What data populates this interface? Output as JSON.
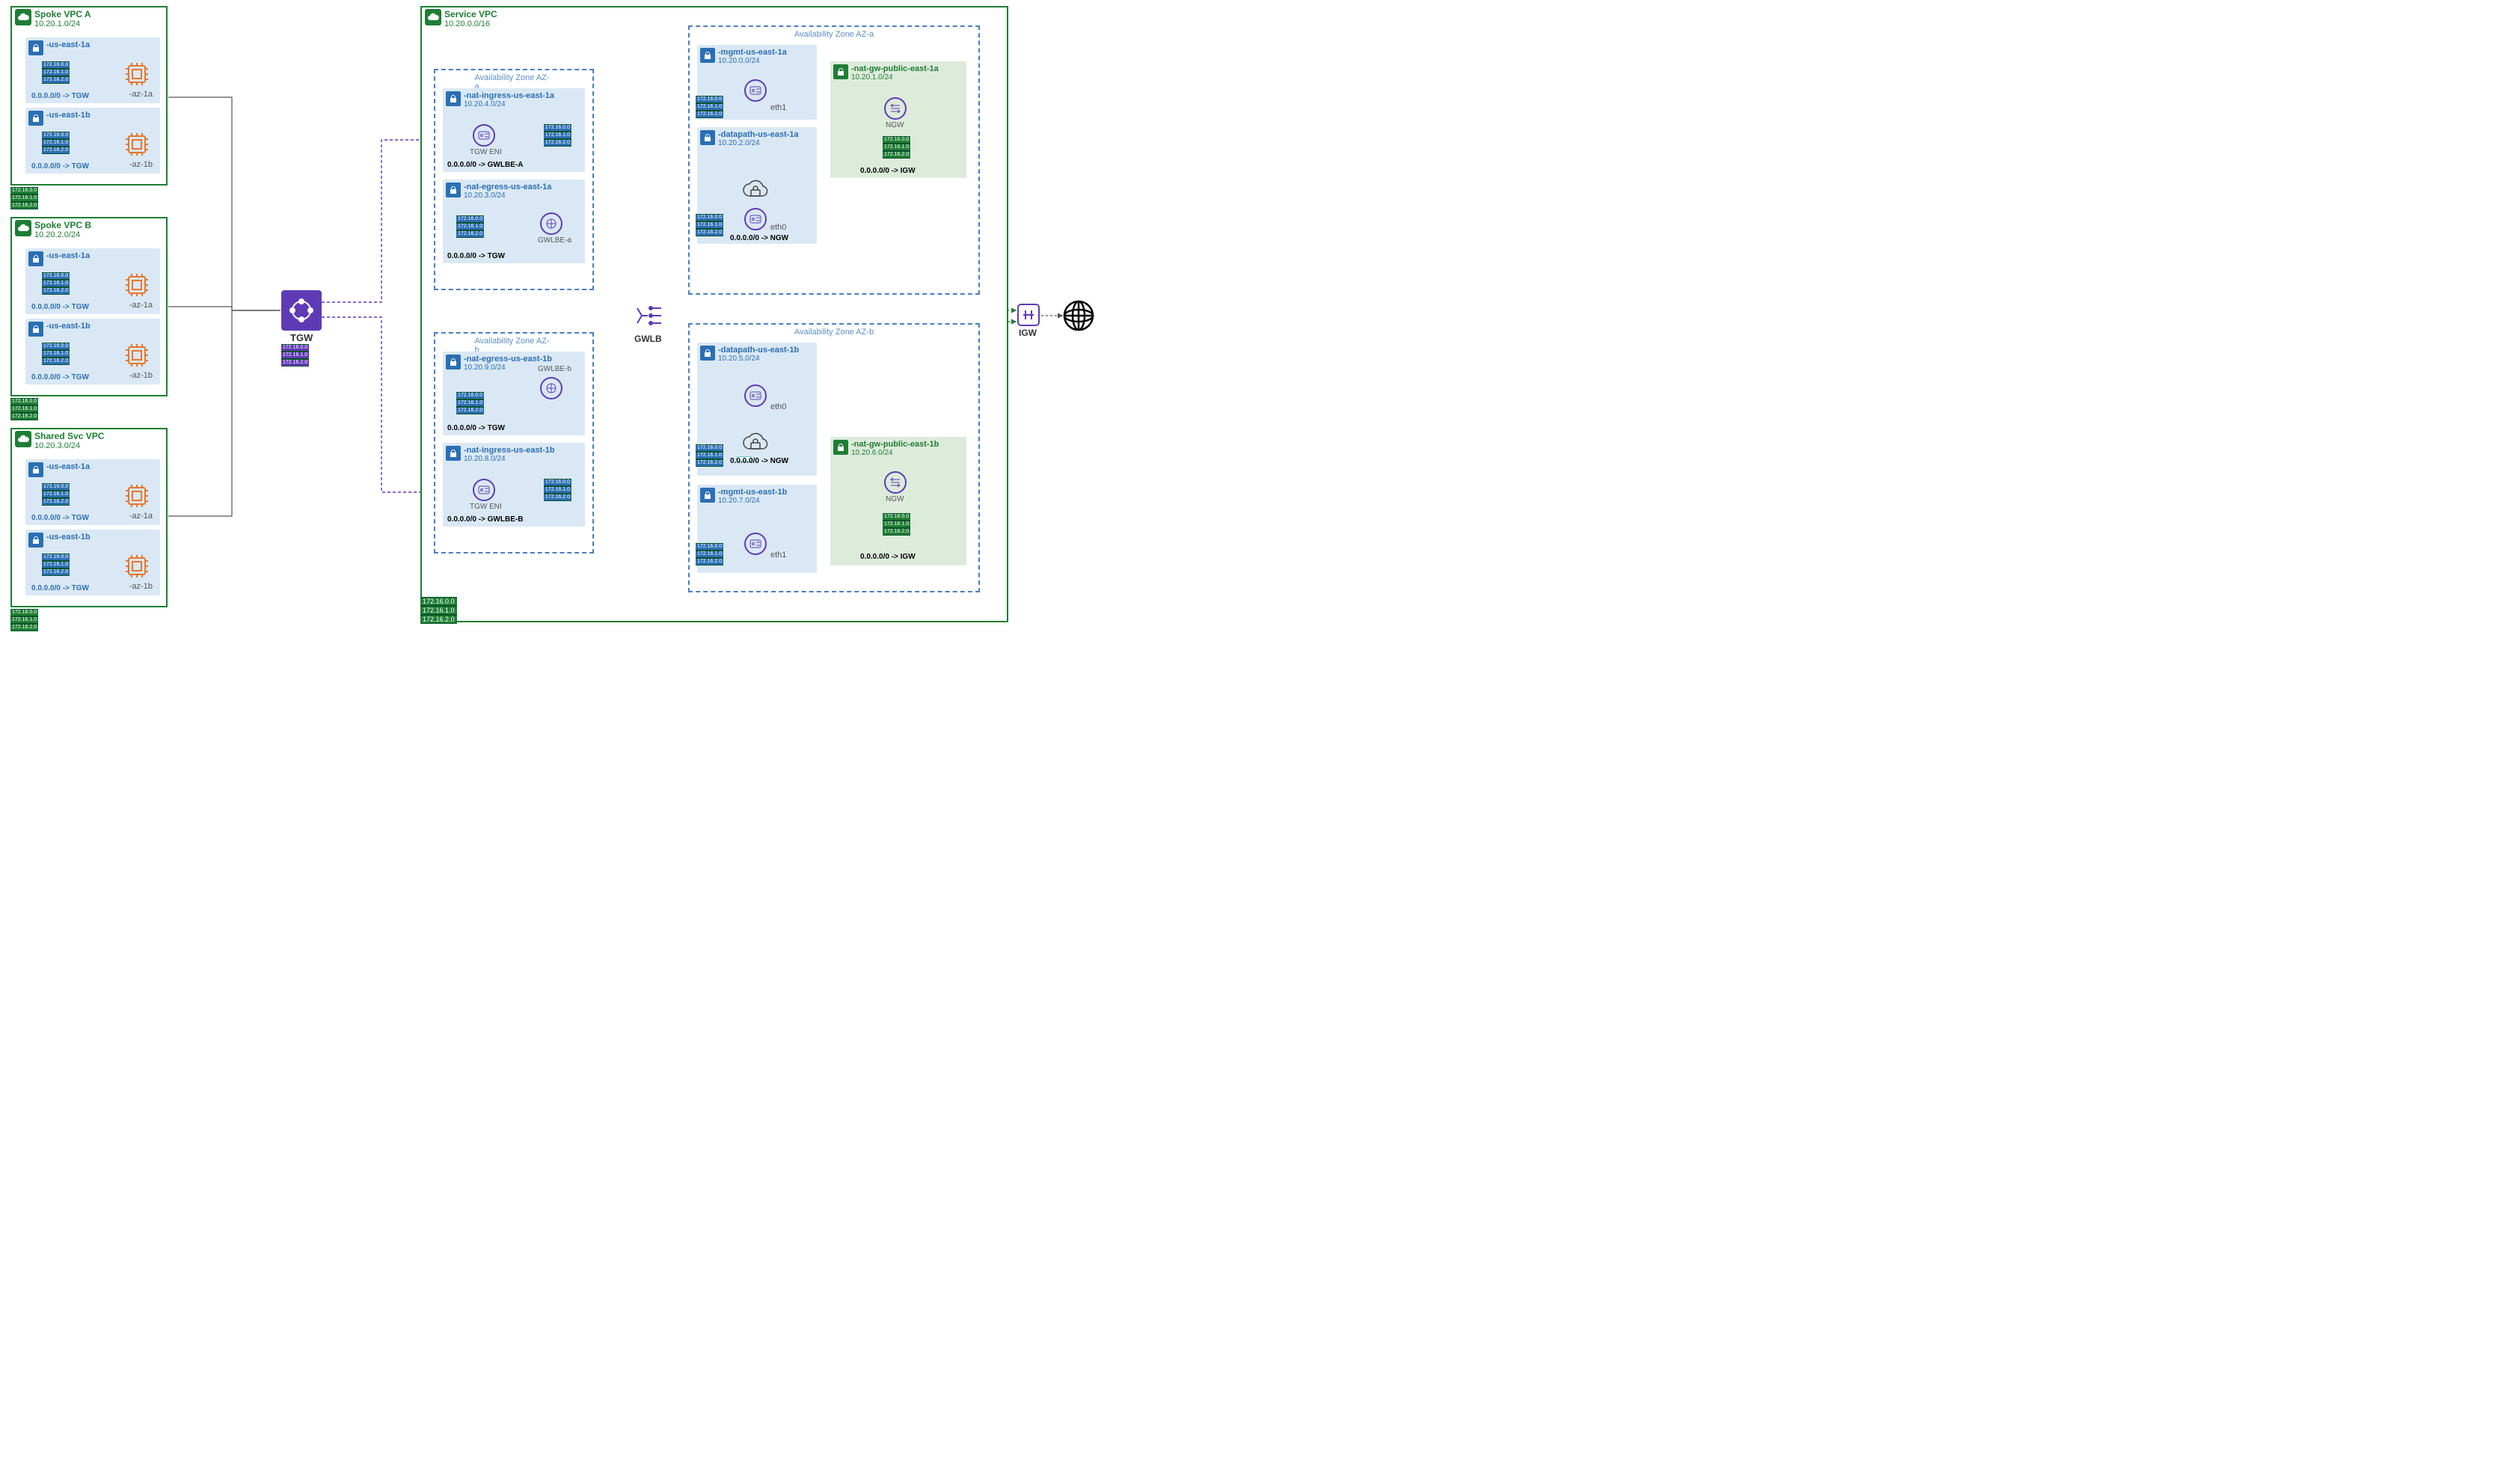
{
  "colors": {
    "green": "#1e7e34",
    "blue": "#2b6fb3",
    "orange": "#e8762d",
    "purple": "#5e3bb5",
    "teal": "#1fb6c1"
  },
  "rt": {
    "r1": "172.16.0.0",
    "r2": "172.16.1.0",
    "r3": "172.16.2.0"
  },
  "rt_svc": {
    "r1": "172.16.0.0",
    "r2": "172.16.1.0",
    "r3": "172.16.2.0"
  },
  "spokeA": {
    "title": "Spoke VPC A",
    "cidr": "10.20.1.0/24",
    "s1": {
      "name": "-us-east-1a",
      "route": "0.0.0.0/0 -> TGW",
      "chip": "-az-1a"
    },
    "s2": {
      "name": "-us-east-1b",
      "route": "0.0.0.0/0 -> TGW",
      "chip": "-az-1b"
    }
  },
  "spokeB": {
    "title": "Spoke VPC B",
    "cidr": "10.20.2.0/24",
    "s1": {
      "name": "-us-east-1a",
      "route": "0.0.0.0/0 -> TGW",
      "chip": "-az-1a"
    },
    "s2": {
      "name": "-us-east-1b",
      "route": "0.0.0.0/0 -> TGW",
      "chip": "-az-1b"
    }
  },
  "shared": {
    "title": "Shared Svc VPC",
    "cidr": "10.20.3.0/24",
    "s1": {
      "name": "-us-east-1a",
      "route": "0.0.0.0/0 -> TGW",
      "chip": "-az-1a"
    },
    "s2": {
      "name": "-us-east-1b",
      "route": "0.0.0.0/0 -> TGW",
      "chip": "-az-1b"
    }
  },
  "tgw": {
    "label": "TGW"
  },
  "service": {
    "title": "Service VPC",
    "cidr": "10.20.0.0/16"
  },
  "azA": {
    "label": "Availability Zone AZ-a",
    "natIngress": {
      "name": "-nat-ingress-us-east-1a",
      "cidr": "10.20.4.0/24",
      "route": "0.0.0.0/0 -> GWLBE-A",
      "eni": "TGW ENI"
    },
    "natEgress": {
      "name": "-nat-egress-us-east-1a",
      "cidr": "10.20.3.0/24",
      "route": "0.0.0.0/0 -> TGW",
      "ep": "GWLBE-a"
    }
  },
  "azB": {
    "label": "Availability Zone AZ-b",
    "natEgress": {
      "name": "-nat-egress-us-east-1b",
      "cidr": "10.20.9.0/24",
      "route": "0.0.0.0/0 -> TGW",
      "ep": "GWLBE-b"
    },
    "natIngress": {
      "name": "-nat-ingress-us-east-1b",
      "cidr": "10.20.8.0/24",
      "route": "0.0.0.0/0 -> GWLBE-B",
      "eni": "TGW ENI"
    }
  },
  "gwlb": {
    "label": "GWLB"
  },
  "azAr": {
    "label": "Availability Zone AZ-a",
    "mgmt": {
      "name": "-mgmt-us-east-1a",
      "cidr": "10.20.0.0/24",
      "eth": "eth1"
    },
    "data": {
      "name": "-datapath-us-east-1a",
      "cidr": "10.20.2.0/24",
      "eth": "eth0",
      "route": "0.0.0.0/0 -> NGW"
    },
    "nat": {
      "name": "-nat-gw-public-east-1a",
      "cidr": "10.20.1.0/24",
      "route": "0.0.0.0/0 -> IGW",
      "ng": "NGW"
    }
  },
  "azBr": {
    "label": "Availability Zone AZ-b",
    "data": {
      "name": "-datapath-us-east-1b",
      "cidr": "10.20.5.0/24",
      "eth": "eth0",
      "route": "0.0.0.0/0 -> NGW"
    },
    "mgmt": {
      "name": "-mgmt-us-east-1b",
      "cidr": "10.20.7.0/24",
      "eth": "eth1"
    },
    "nat": {
      "name": "-nat-gw-public-east-1b",
      "cidr": "10.20.6.0/24",
      "route": "0.0.0.0/0 -> IGW",
      "ng": "NGW"
    }
  },
  "igw": {
    "label": "IGW"
  }
}
